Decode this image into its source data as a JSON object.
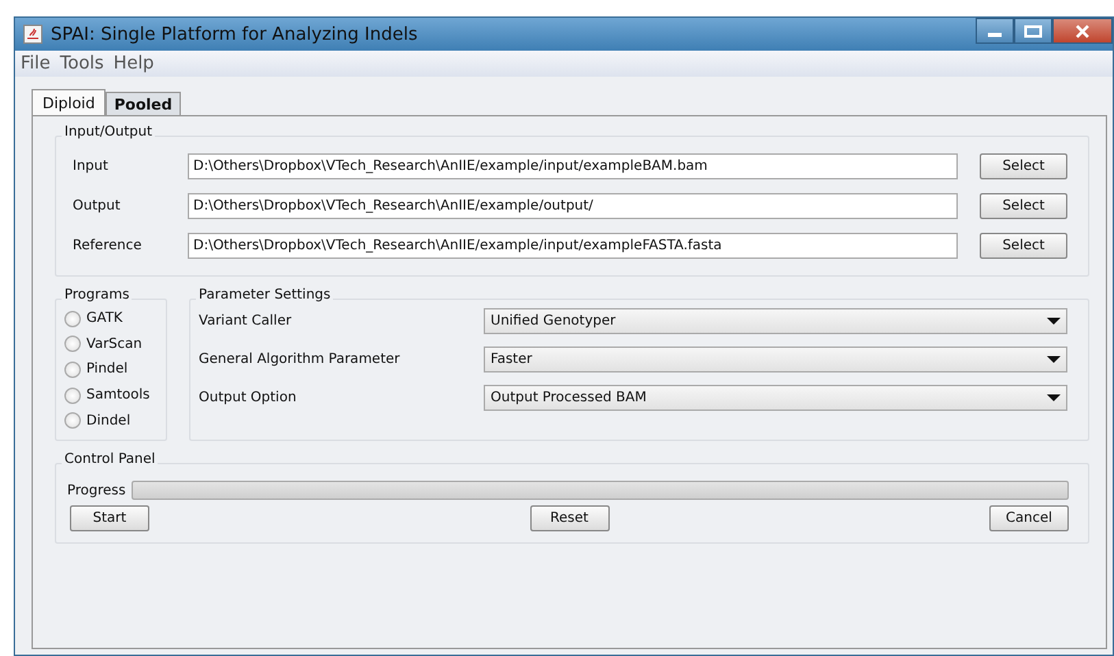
{
  "window": {
    "title": "SPAI: Single Platform for Analyzing Indels"
  },
  "menu": [
    "File",
    "Tools",
    "Help"
  ],
  "tabs": [
    {
      "label": "Diploid",
      "selected": true
    },
    {
      "label": "Pooled",
      "selected": false
    }
  ],
  "input_output": {
    "title": "Input/Output",
    "rows": [
      {
        "label": "Input",
        "value": "D:\\Others\\Dropbox\\VTech_Research\\AnIIE/example/input/exampleBAM.bam",
        "button": "Select"
      },
      {
        "label": "Output",
        "value": "D:\\Others\\Dropbox\\VTech_Research\\AnIIE/example/output/",
        "button": "Select"
      },
      {
        "label": "Reference",
        "value": "D:\\Others\\Dropbox\\VTech_Research\\AnIIE/example/input/exampleFASTA.fasta",
        "button": "Select"
      }
    ]
  },
  "programs": {
    "title": "Programs",
    "items": [
      {
        "label": "GATK",
        "selected": false
      },
      {
        "label": "VarScan",
        "selected": false
      },
      {
        "label": "Pindel",
        "selected": false
      },
      {
        "label": "Samtools",
        "selected": false
      },
      {
        "label": "Dindel",
        "selected": false
      }
    ]
  },
  "parameter_settings": {
    "title": "Parameter Settings",
    "rows": [
      {
        "label": "Variant Caller",
        "value": "Unified Genotyper"
      },
      {
        "label": "General Algorithm Parameter",
        "value": "Faster"
      },
      {
        "label": "Output Option",
        "value": "Output Processed BAM"
      }
    ]
  },
  "control_panel": {
    "title": "Control Panel",
    "progress_label": "Progress",
    "level": 0,
    "buttons": [
      "Start",
      "Reset",
      "Cancel"
    ]
  }
}
